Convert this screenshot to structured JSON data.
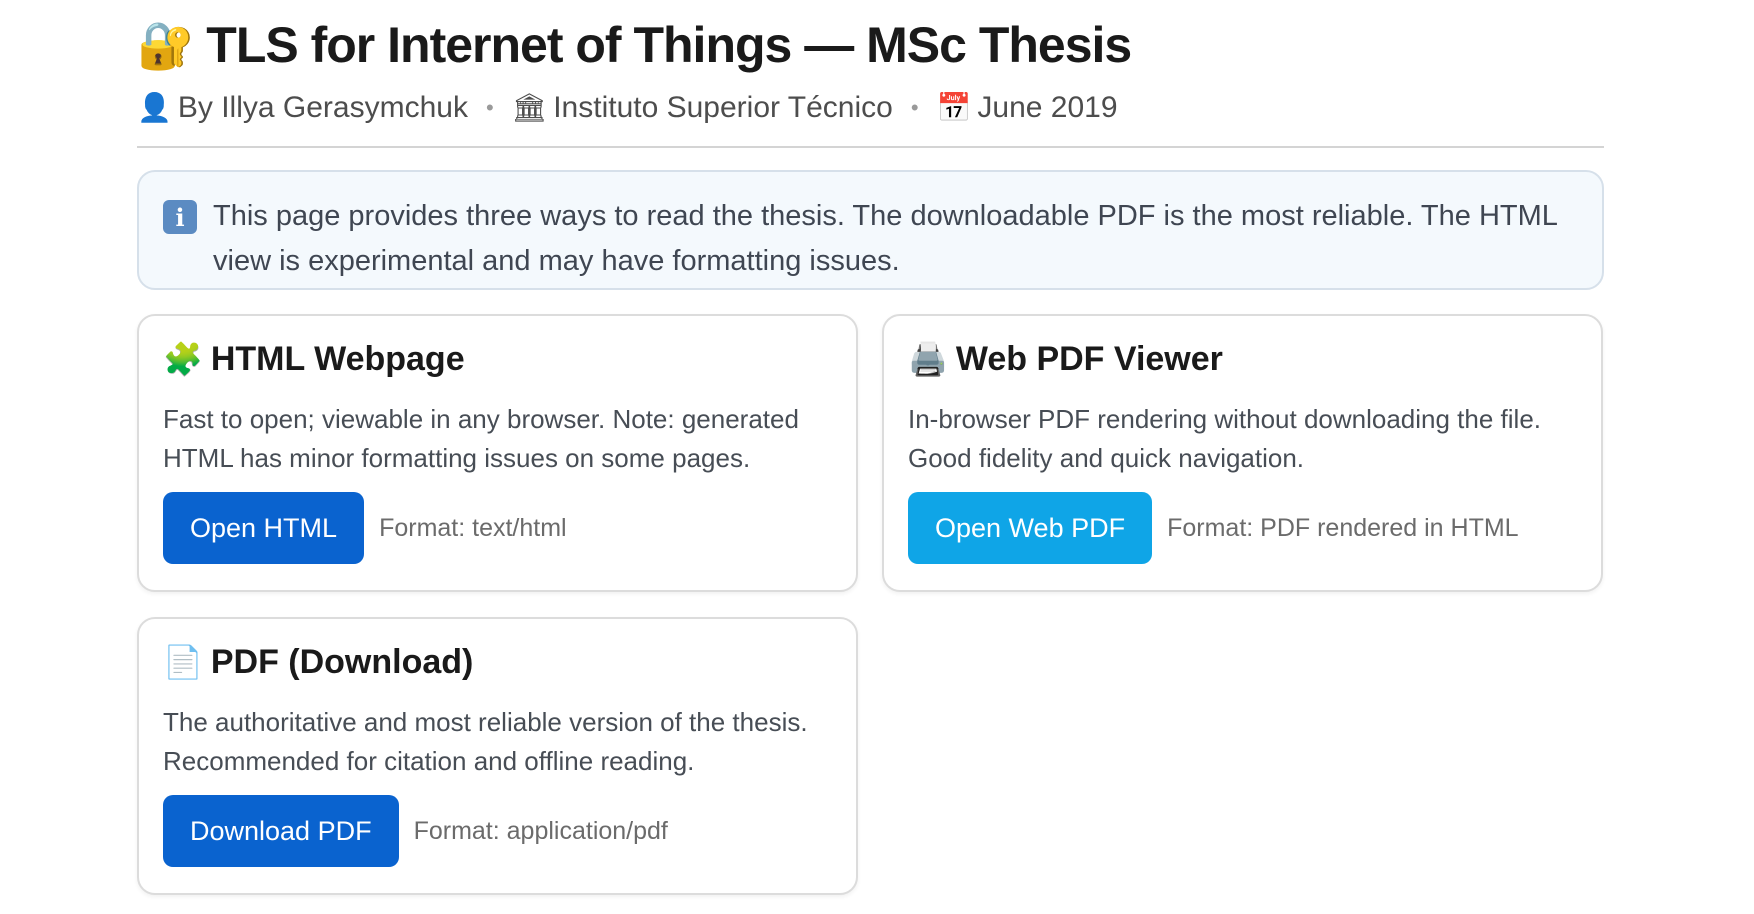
{
  "header": {
    "title_icon": "🔐",
    "title": "TLS for Internet of Things — MSc Thesis",
    "meta": [
      {
        "icon": "👤",
        "text": "By Illya Gerasymchuk"
      },
      {
        "icon": "🏛",
        "text": "Instituto Superior Técnico"
      },
      {
        "icon": "📅",
        "text": "June 2019"
      }
    ],
    "separator": "•"
  },
  "notice": {
    "icon": "i",
    "text": "This page provides three ways to read the thesis. The downloadable PDF is the most reliable. The HTML view is experimental and may have formatting issues."
  },
  "cards": [
    {
      "icon": "🧩",
      "title": "HTML Webpage",
      "description": "Fast to open; viewable in any browser. Note: generated HTML has minor formatting issues on some pages.",
      "button_label": "Open HTML",
      "button_color": "#0a63cf",
      "format": "Format: text/html"
    },
    {
      "icon": "🖨️",
      "title": "Web PDF Viewer",
      "description": "In-browser PDF rendering without downloading the file. Good fidelity and quick navigation.",
      "button_label": "Open Web PDF",
      "button_color": "#0fa5e7",
      "format": "Format: PDF rendered in HTML"
    },
    {
      "icon": "📄",
      "title": "PDF (Download)",
      "description": "The authoritative and most reliable version of the thesis. Recommended for citation and offline reading.",
      "button_label": "Download PDF",
      "button_color": "#0a63cf",
      "format": "Format: application/pdf"
    }
  ]
}
